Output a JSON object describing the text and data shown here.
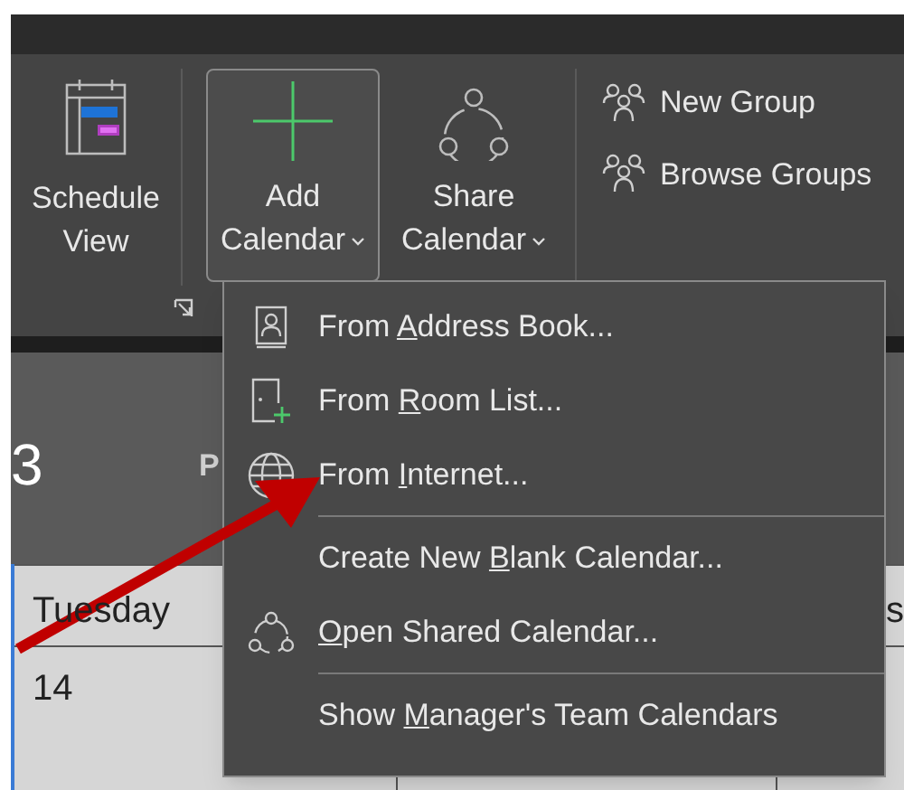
{
  "ribbon": {
    "schedule_view": {
      "line_1": "Schedule",
      "line_2": "View"
    },
    "add_calendar": {
      "line_1": "Add",
      "line_2": "Calendar",
      "selected": true
    },
    "share_calendar": {
      "line_1": "Share",
      "line_2": "Calendar",
      "selected": false
    },
    "group_items": [
      {
        "label": "New Group"
      },
      {
        "label": "Browse Groups"
      }
    ]
  },
  "calendar": {
    "date_fragment": "3",
    "header_fragment": "P",
    "day_header": "Tuesday",
    "right_header_fragment": "s",
    "date_cell": "14"
  },
  "menu": {
    "items": [
      {
        "kind": "address-book",
        "before": "From ",
        "key": "A",
        "after": "ddress Book...",
        "divider_before": false
      },
      {
        "kind": "room-list",
        "before": "From ",
        "key": "R",
        "after": "oom List...",
        "divider_before": false
      },
      {
        "kind": "globe",
        "before": "From ",
        "key": "I",
        "after": "nternet...",
        "divider_before": false
      },
      {
        "kind": "none",
        "before": "Create New ",
        "key": "B",
        "after": "lank Calendar...",
        "divider_before": true
      },
      {
        "kind": "share",
        "key": "O",
        "after": "pen Shared Calendar...",
        "divider_before": false
      },
      {
        "kind": "none",
        "before": "Show ",
        "key": "M",
        "after": "anager's Team Calendars",
        "divider_before": true
      }
    ]
  }
}
